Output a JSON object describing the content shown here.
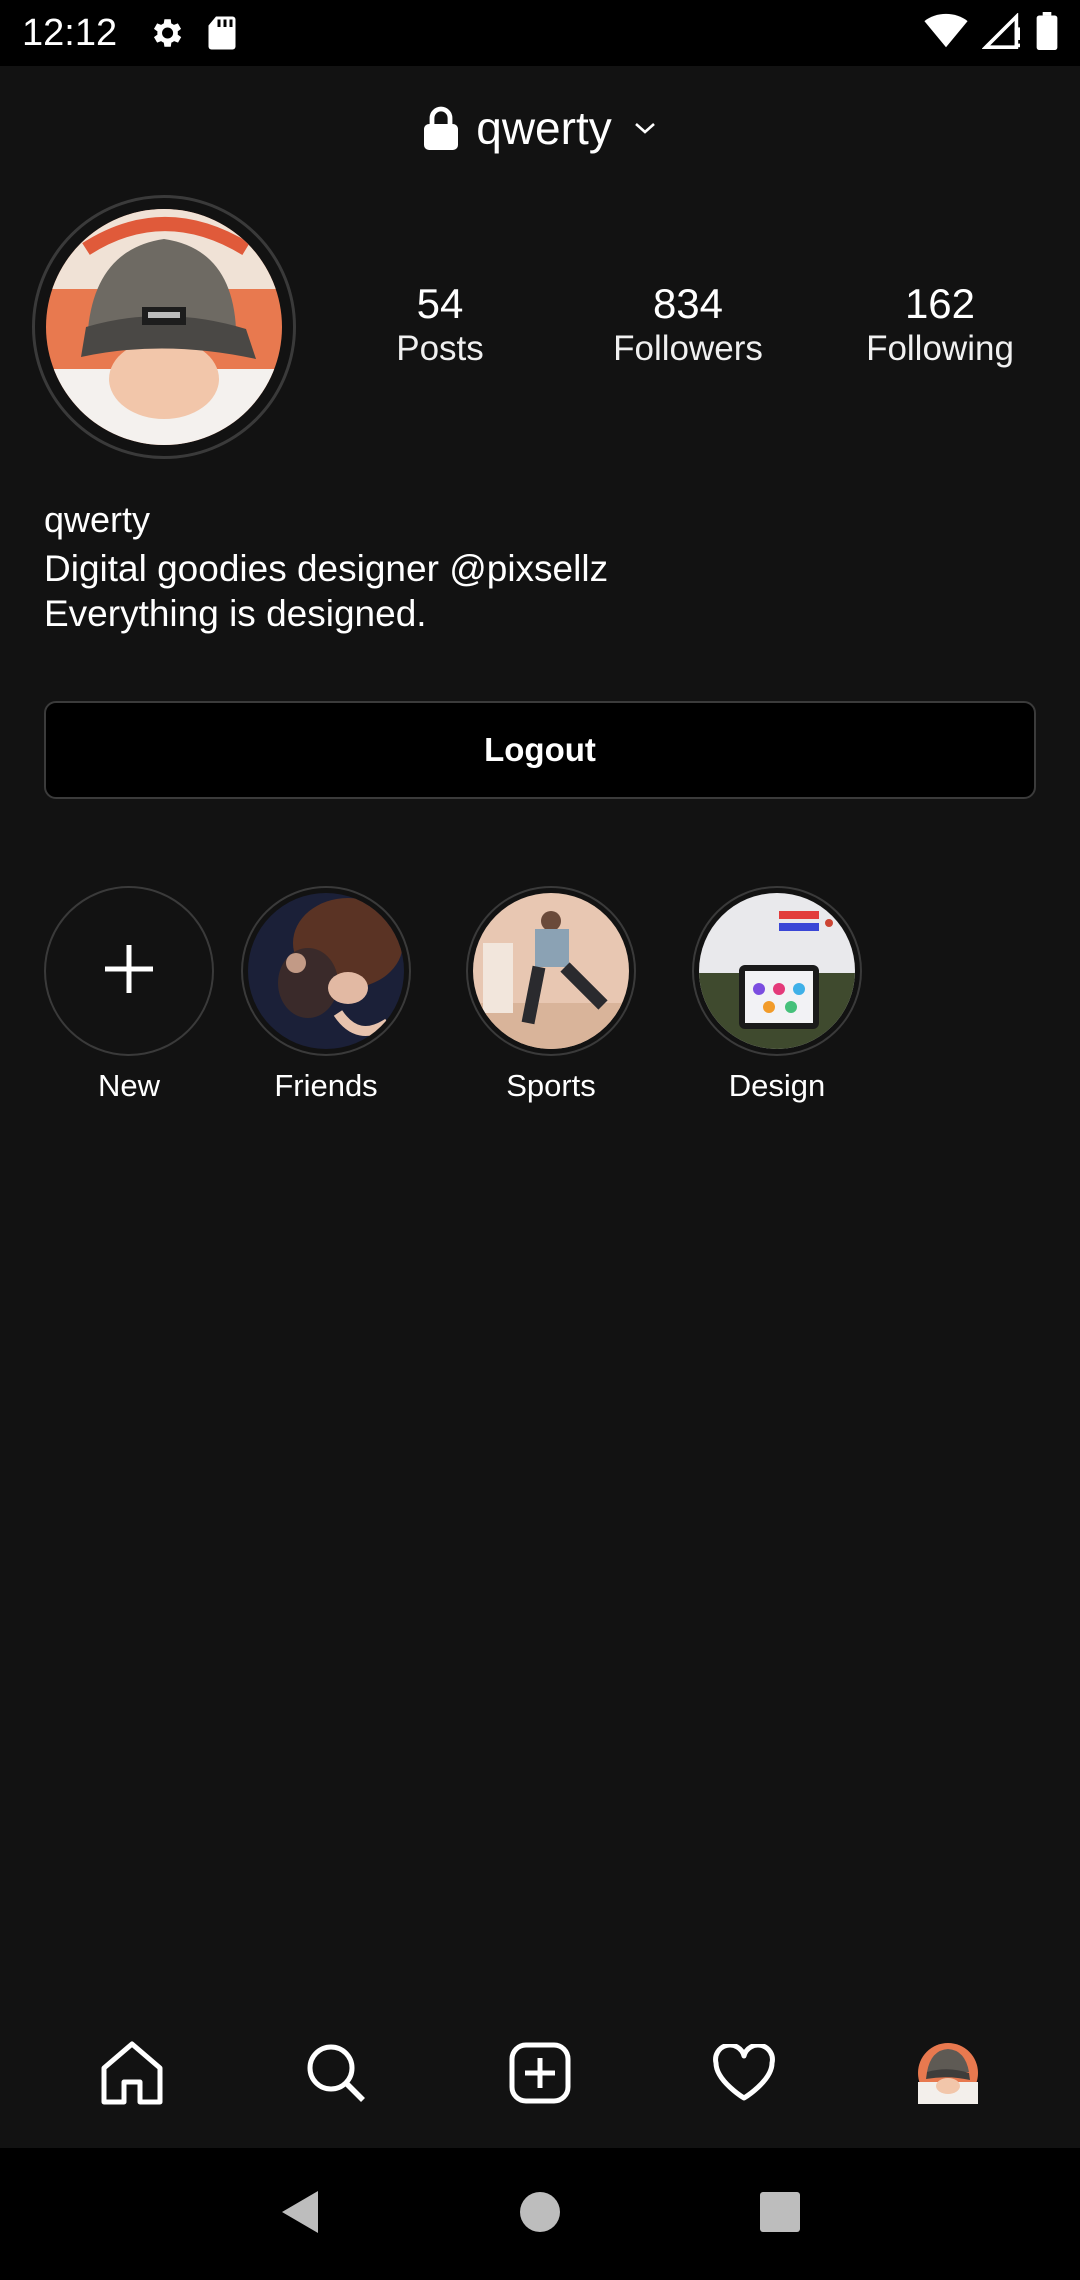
{
  "status_bar": {
    "time": "12:12",
    "icons_left": [
      "settings-icon",
      "sd-card-icon"
    ],
    "icons_right": [
      "wifi-icon",
      "cell-signal-icon",
      "battery-icon"
    ]
  },
  "header": {
    "username": "qwerty",
    "icons": [
      "lock-icon",
      "chevron-down-icon"
    ]
  },
  "profile": {
    "stats": [
      {
        "value": "54",
        "label": "Posts"
      },
      {
        "value": "834",
        "label": "Followers"
      },
      {
        "value": "162",
        "label": "Following"
      }
    ],
    "name": "qwerty",
    "bio_lines": [
      "Digital goodies designer @pixsellz",
      "Everything is designed."
    ],
    "logout_label": "Logout"
  },
  "highlights": [
    {
      "label": "New"
    },
    {
      "label": "Friends"
    },
    {
      "label": "Sports"
    },
    {
      "label": "Design"
    }
  ],
  "bottom_nav": [
    "home-icon",
    "search-icon",
    "add-post-icon",
    "heart-icon",
    "profile-avatar"
  ],
  "system_nav": [
    "back-button",
    "home-button",
    "recents-button"
  ],
  "colors": {
    "background": "#121212",
    "bars": "#000000",
    "text": "#ffffff",
    "ring": "#3a3a3a"
  }
}
